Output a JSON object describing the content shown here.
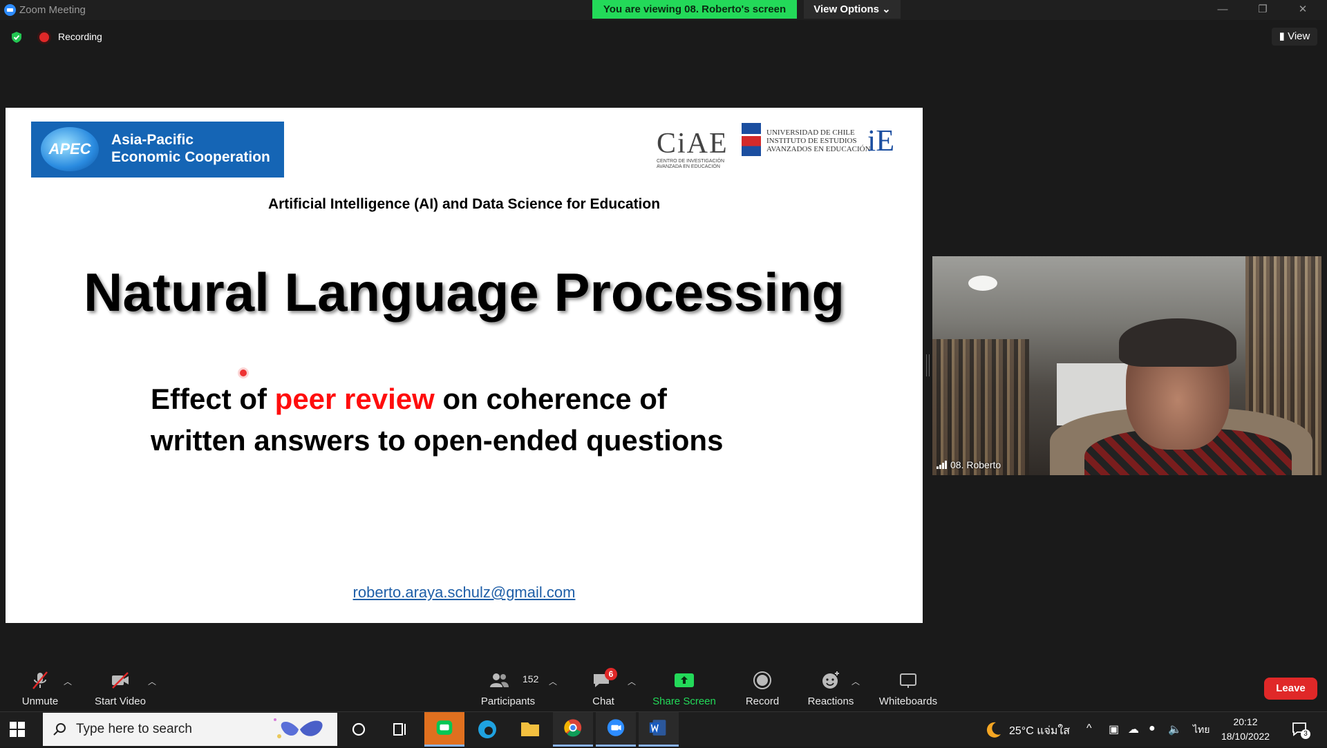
{
  "window": {
    "title": "Zoom Meeting",
    "viewing_banner": "You are viewing 08. Roberto's screen",
    "view_options": "View Options ⌄",
    "minimize": "—",
    "restore": "❐",
    "close": "✕"
  },
  "status": {
    "recording_label": "Recording",
    "view_button": "View"
  },
  "slide": {
    "apec_logo_globe": "APEC",
    "apec_logo_line1": "Asia-Pacific",
    "apec_logo_line2": "Economic Cooperation",
    "ciae_logo": "CiAE",
    "ciae_logo_sub1": "Centro de Investigación",
    "ciae_logo_sub2": "Avanzada en Educación",
    "uchile_line1": "UNIVERSIDAD DE CHILE",
    "uchile_line2": "INSTITUTO DE ESTUDIOS",
    "uchile_line3": "AVANZADOS EN EDUCACIÓN",
    "uchile_ie": "iE",
    "event_title": "Artificial Intelligence (AI) and Data Science for Education",
    "main_title": "Natural Language Processing",
    "subtitle_part1": "Effect of ",
    "subtitle_highlight": "peer review",
    "subtitle_part2": " on coherence of",
    "subtitle_line2": "written answers to open-ended questions",
    "email": "roberto.araya.schulz@gmail.com"
  },
  "video": {
    "participant_name": "08. Roberto"
  },
  "toolbar": {
    "unmute": "Unmute",
    "start_video": "Start Video",
    "participants": "Participants",
    "participants_count": "152",
    "chat": "Chat",
    "chat_badge": "6",
    "share_screen": "Share Screen",
    "record": "Record",
    "reactions": "Reactions",
    "whiteboards": "Whiteboards",
    "leave": "Leave"
  },
  "taskbar": {
    "search_placeholder": "Type here to search",
    "weather": "25°C แจ่มใส",
    "language": "ไทย",
    "time": "20:12",
    "date": "18/10/2022",
    "notification_count": "3"
  },
  "colors": {
    "banner_green": "#23d959",
    "leave_red": "#e02828",
    "highlight_red": "#ff0d0d",
    "share_green": "#23d959"
  }
}
